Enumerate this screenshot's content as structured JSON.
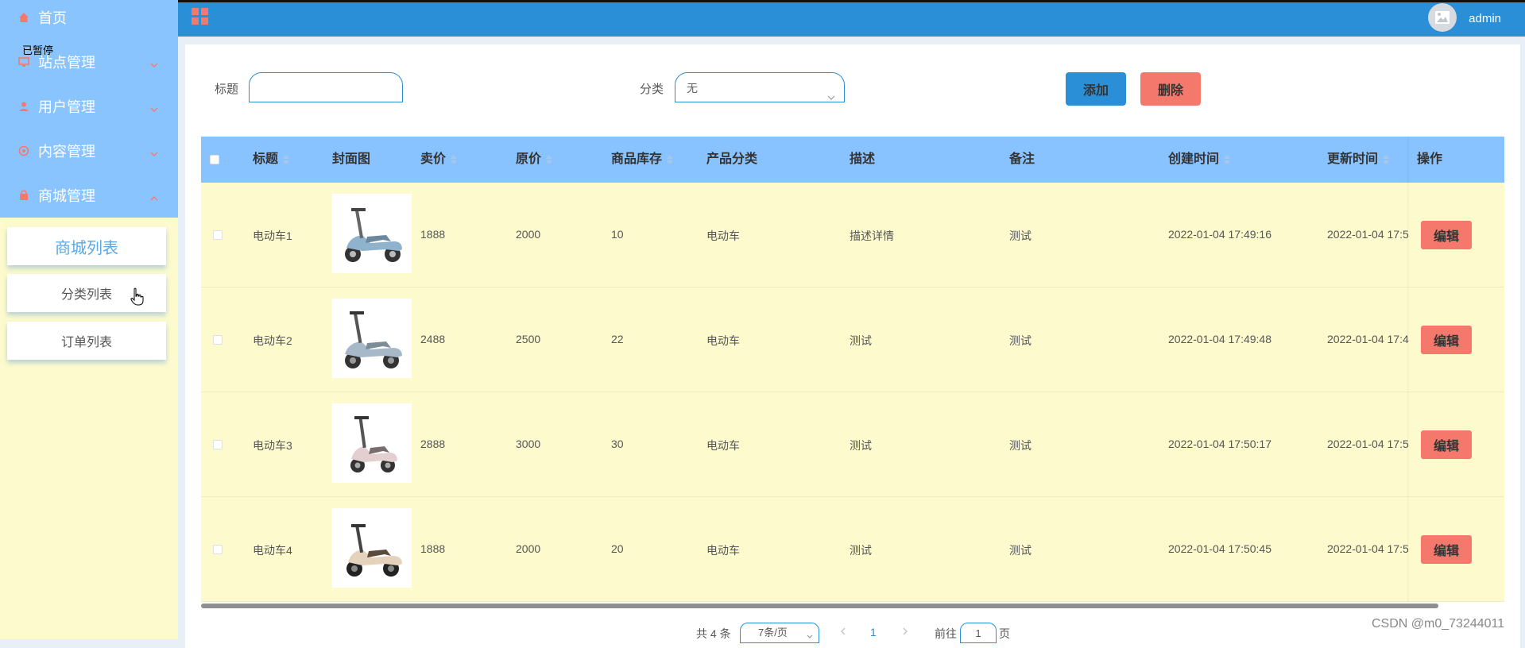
{
  "sidebar": {
    "items": [
      {
        "label": "首页",
        "icon": "home-icon"
      },
      {
        "label": "站点管理",
        "icon": "monitor-icon"
      },
      {
        "label": "用户管理",
        "icon": "user-icon"
      },
      {
        "label": "内容管理",
        "icon": "content-icon"
      },
      {
        "label": "商城管理",
        "icon": "shop-icon"
      }
    ],
    "paused_label": "已暂停",
    "sub_items": [
      "商城列表",
      "分类列表",
      "订单列表"
    ]
  },
  "header": {
    "username": "admin"
  },
  "filters": {
    "title_label": "标题",
    "title_value": "",
    "category_label": "分类",
    "category_value": "无",
    "add_label": "添加",
    "delete_label": "删除"
  },
  "table": {
    "columns": [
      "标题",
      "封面图",
      "卖价",
      "原价",
      "商品库存",
      "产品分类",
      "描述",
      "备注",
      "创建时间",
      "更新时间",
      "操作"
    ],
    "rows": [
      {
        "title": "电动车1",
        "sell_price": "1888",
        "orig_price": "2000",
        "stock": "10",
        "category": "电动车",
        "desc": "描述详情",
        "note": "测试",
        "created": "2022-01-04 17:49:16",
        "updated": "2022-01-04 17:5"
      },
      {
        "title": "电动车2",
        "sell_price": "2488",
        "orig_price": "2500",
        "stock": "22",
        "category": "电动车",
        "desc": "测试",
        "note": "测试",
        "created": "2022-01-04 17:49:48",
        "updated": "2022-01-04 17:4"
      },
      {
        "title": "电动车3",
        "sell_price": "2888",
        "orig_price": "3000",
        "stock": "30",
        "category": "电动车",
        "desc": "测试",
        "note": "测试",
        "created": "2022-01-04 17:50:17",
        "updated": "2022-01-04 17:5"
      },
      {
        "title": "电动车4",
        "sell_price": "1888",
        "orig_price": "2000",
        "stock": "20",
        "category": "电动车",
        "desc": "测试",
        "note": "测试",
        "created": "2022-01-04 17:50:45",
        "updated": "2022-01-04 17:5"
      }
    ],
    "edit_label": "编辑"
  },
  "pagination": {
    "total": "共 4 条",
    "page_size": "7条/页",
    "current_page": "1",
    "goto_label": "前往",
    "goto_value": "1",
    "page_suffix": "页"
  },
  "watermark": "CSDN @m0_73244011",
  "colors": {
    "accent": "#2a8fd6",
    "danger": "#f5786d",
    "menu_bg": "#8ac4ff",
    "row_bg": "#fdfbcd"
  }
}
